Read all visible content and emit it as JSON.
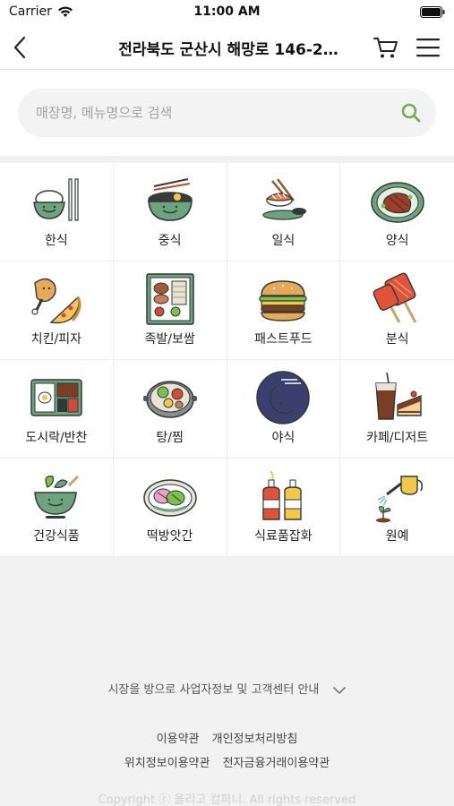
{
  "status": {
    "carrier": "Carrier",
    "time": "11:00 AM"
  },
  "nav": {
    "title": "전라북도 군산시 해망로 146-2…"
  },
  "search": {
    "placeholder": "매장명, 메뉴명으로 검색"
  },
  "categories": [
    {
      "label": "한식",
      "icon": "rice-bowl-icon"
    },
    {
      "label": "중식",
      "icon": "noodle-bowl-icon"
    },
    {
      "label": "일식",
      "icon": "sushi-icon"
    },
    {
      "label": "양식",
      "icon": "steak-icon"
    },
    {
      "label": "치킨/피자",
      "icon": "chicken-pizza-icon"
    },
    {
      "label": "족발/보쌈",
      "icon": "pork-box-icon"
    },
    {
      "label": "패스트푸드",
      "icon": "burger-icon"
    },
    {
      "label": "분식",
      "icon": "skewer-icon"
    },
    {
      "label": "도시락/반찬",
      "icon": "lunchbox-icon"
    },
    {
      "label": "탕/찜",
      "icon": "hotpot-icon"
    },
    {
      "label": "야식",
      "icon": "moon-icon"
    },
    {
      "label": "카페/디저트",
      "icon": "coffee-cake-icon"
    },
    {
      "label": "건강식품",
      "icon": "healthy-bowl-icon"
    },
    {
      "label": "떡방앗간",
      "icon": "rice-cake-icon"
    },
    {
      "label": "식료품잡화",
      "icon": "sauce-bottles-icon"
    },
    {
      "label": "원예",
      "icon": "watering-can-icon"
    }
  ],
  "footer": {
    "info": "시장을 방으로 사업자정보 및 고객센터 안내",
    "terms": "이용약관",
    "privacy": "개인정보처리방침",
    "location_terms": "위치정보이용약관",
    "finance_terms": "전자금융거래이용약관",
    "copyright": "Copyright ⓒ 올리고 컴퍼니. All rights reserved"
  },
  "colors": {
    "accent": "#7aa85c",
    "icon_green": "#6fa27e",
    "icon_outline": "#2f3a36"
  }
}
